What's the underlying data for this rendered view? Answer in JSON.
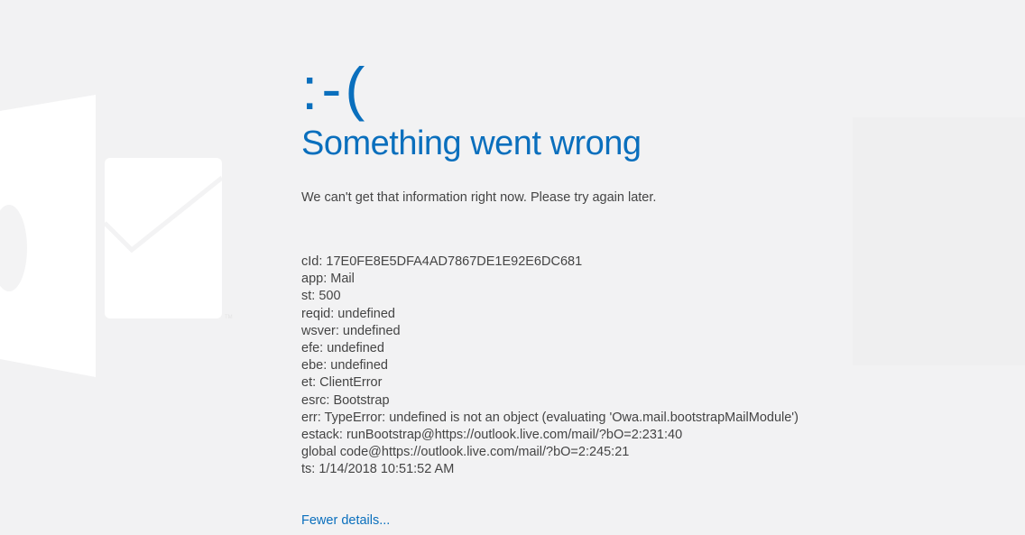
{
  "error": {
    "face": ":-(",
    "title": "Something went wrong",
    "message": "We can't get that information right now. Please try again later."
  },
  "details": [
    "cId: 17E0FE8E5DFA4AD7867DE1E92E6DC681",
    "app: Mail",
    "st: 500",
    "reqid: undefined",
    "wsver: undefined",
    "efe: undefined",
    "ebe: undefined",
    "et: ClientError",
    "esrc: Bootstrap",
    "err: TypeError: undefined is not an object (evaluating 'Owa.mail.bootstrapMailModule')",
    "estack: runBootstrap@https://outlook.live.com/mail/?bO=2:231:40",
    "global code@https://outlook.live.com/mail/?bO=2:245:21",
    "ts: 1/14/2018 10:51:52 AM"
  ],
  "toggle_label": "Fewer details...",
  "colors": {
    "accent": "#0a6fbd",
    "background": "#f2f2f3",
    "logo": "#ffffff",
    "text": "#444444"
  },
  "icons": {
    "logo": "outlook-logo-icon"
  }
}
